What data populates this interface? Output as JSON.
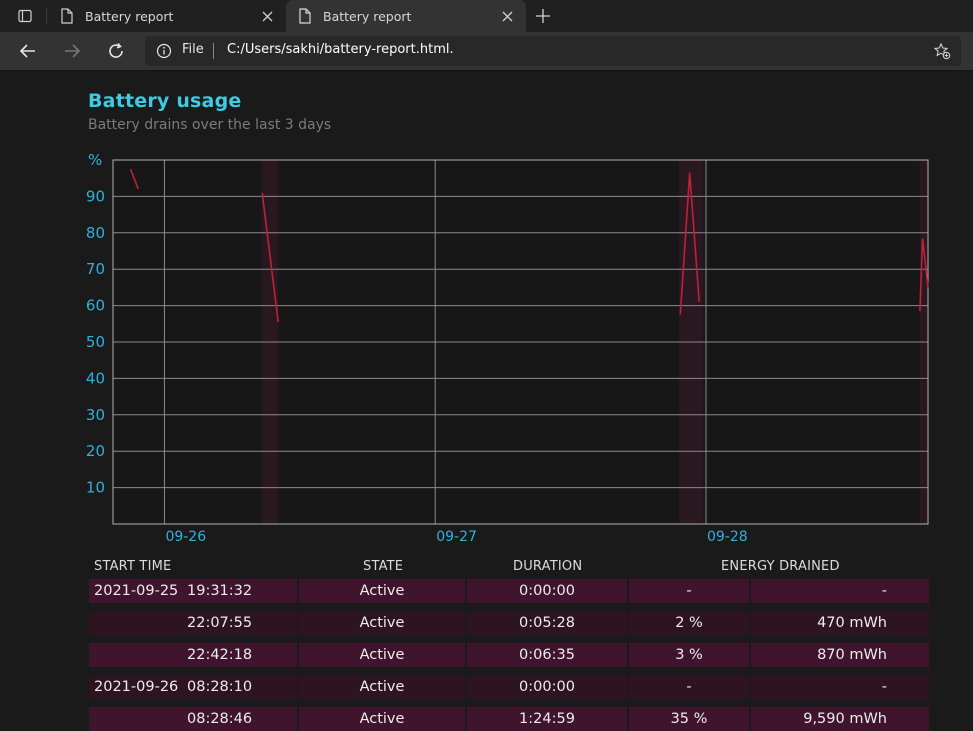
{
  "browser": {
    "tabs": [
      {
        "label": "Battery report",
        "active": false
      },
      {
        "label": "Battery report",
        "active": true
      }
    ],
    "address": {
      "scheme_label": "File",
      "url": "C:/Users/sakhi/battery-report.html."
    }
  },
  "report": {
    "heading": "Battery usage",
    "subheading": "Battery drains over the last 3 days"
  },
  "chart_data": {
    "type": "line",
    "ylabel": "%",
    "ylim": [
      0,
      100
    ],
    "yticks": [
      10,
      20,
      30,
      40,
      50,
      60,
      70,
      80,
      90
    ],
    "x_tick_labels": [
      "09-26",
      "09-27",
      "09-28"
    ],
    "x_range_days": [
      -0.19,
      2.82
    ],
    "grid": true,
    "line_color": "#c0203a",
    "series": [
      {
        "points": [
          [
            -0.125,
            97.5
          ],
          [
            -0.097,
            92.0
          ]
        ]
      },
      {
        "points": [
          [
            0.361,
            91.0
          ],
          [
            0.42,
            55.5
          ]
        ]
      },
      {
        "points": [
          [
            1.905,
            57.5
          ],
          [
            1.94,
            96.5
          ],
          [
            1.975,
            61.0
          ]
        ]
      },
      {
        "points": [
          [
            2.79,
            58.5
          ],
          [
            2.8,
            78.5
          ],
          [
            2.82,
            65.0
          ]
        ]
      }
    ],
    "active_bands": [
      [
        0.36,
        0.42
      ],
      [
        1.9,
        1.99
      ],
      [
        2.79,
        2.82
      ]
    ]
  },
  "table": {
    "headers": [
      "START TIME",
      "STATE",
      "DURATION",
      "ENERGY DRAINED"
    ],
    "rows": [
      {
        "date": "2021-09-25",
        "time": "19:31:32",
        "state": "Active",
        "duration": "0:00:00",
        "percent": "-",
        "energy": "-"
      },
      {
        "date": "",
        "time": "22:07:55",
        "state": "Active",
        "duration": "0:05:28",
        "percent": "2 %",
        "energy": "470 mWh"
      },
      {
        "date": "",
        "time": "22:42:18",
        "state": "Active",
        "duration": "0:06:35",
        "percent": "3 %",
        "energy": "870 mWh"
      },
      {
        "date": "2021-09-26",
        "time": "08:28:10",
        "state": "Active",
        "duration": "0:00:00",
        "percent": "-",
        "energy": "-"
      },
      {
        "date": "",
        "time": "08:28:46",
        "state": "Active",
        "duration": "1:24:59",
        "percent": "35 %",
        "energy": "9,590 mWh"
      }
    ]
  }
}
